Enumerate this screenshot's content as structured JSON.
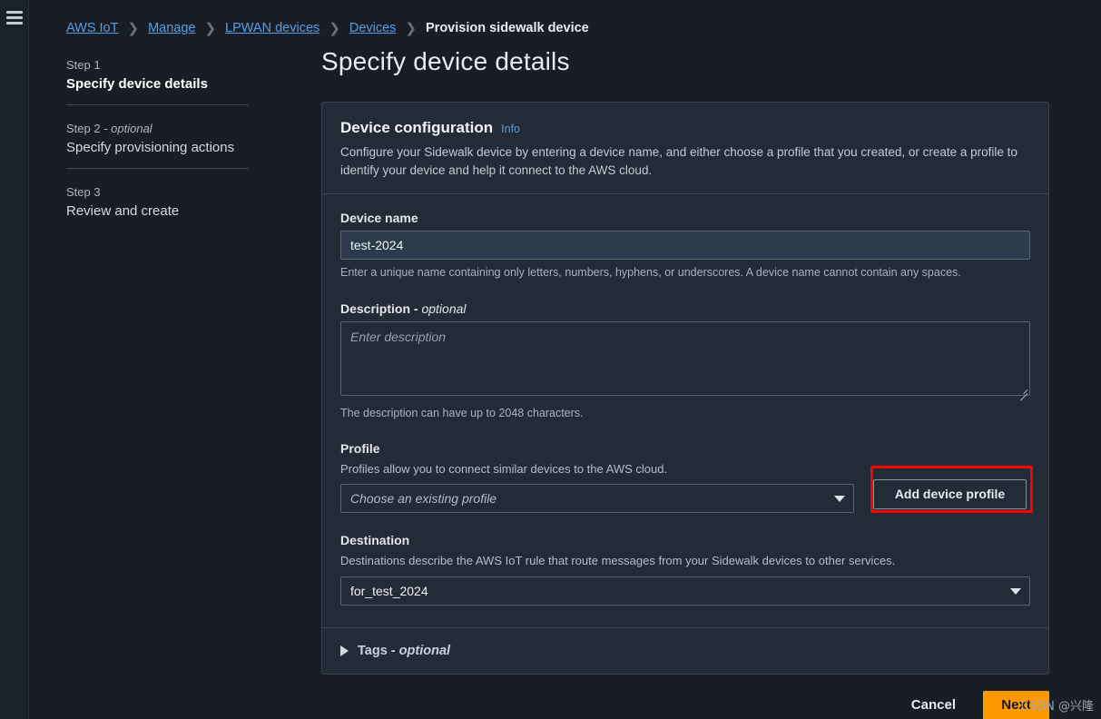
{
  "rail": {
    "menu_icon": "hamburger-menu-icon"
  },
  "breadcrumb": {
    "items": [
      {
        "label": "AWS IoT",
        "current": false
      },
      {
        "label": "Manage",
        "current": false
      },
      {
        "label": "LPWAN devices",
        "current": false
      },
      {
        "label": "Devices",
        "current": false
      },
      {
        "label": "Provision sidewalk device",
        "current": true
      }
    ],
    "separator": "›"
  },
  "steps": [
    {
      "num": "Step 1",
      "optional": "",
      "title": "Specify device details",
      "active": true
    },
    {
      "num": "Step 2",
      "optional": " - optional",
      "title": "Specify provisioning actions",
      "active": false
    },
    {
      "num": "Step 3",
      "optional": "",
      "title": "Review and create",
      "active": false
    }
  ],
  "page": {
    "title": "Specify device details"
  },
  "card": {
    "title": "Device configuration",
    "info_label": "Info",
    "description": "Configure your Sidewalk device by entering a device name, and either choose a profile that you created, or create a profile to identify your device and help it connect to the AWS cloud."
  },
  "device_name": {
    "label": "Device name",
    "value": "test-2024",
    "hint": "Enter a unique name containing only letters, numbers, hyphens, or underscores. A device name cannot contain any spaces."
  },
  "description_field": {
    "label": "Description - ",
    "label_optional": "optional",
    "placeholder": "Enter description",
    "value": "",
    "hint": "The description can have up to 2048 characters."
  },
  "profile": {
    "label": "Profile",
    "sublabel": "Profiles allow you to connect similar devices to the AWS cloud.",
    "select_value": "Choose an existing profile",
    "add_button": "Add device profile",
    "highlight_color": "#ff0000"
  },
  "destination": {
    "label": "Destination",
    "sublabel": "Destinations describe the AWS IoT rule that route messages from your Sidewalk devices to other services.",
    "select_value": "for_test_2024"
  },
  "tags": {
    "label": "Tags - ",
    "label_optional": "optional"
  },
  "footer": {
    "cancel": "Cancel",
    "next": "Next",
    "next_color": "#ff9900"
  },
  "watermark": {
    "text": "CSDN @兴隆"
  }
}
